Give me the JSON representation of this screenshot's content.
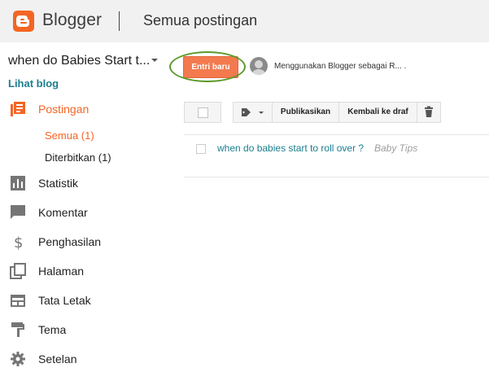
{
  "header": {
    "brand": "Blogger",
    "page_title": "Semua postingan"
  },
  "blog": {
    "name": "when do Babies Start t...",
    "view_blog_label": "Lihat blog"
  },
  "actions": {
    "new_post_label": "Entri baru",
    "using_as": "Menggunakan Blogger sebagai R... ."
  },
  "sidebar": {
    "items": [
      {
        "label": "Postingan",
        "icon": "posts-icon",
        "active": true
      },
      {
        "label": "Statistik",
        "icon": "stats-icon"
      },
      {
        "label": "Komentar",
        "icon": "comment-icon"
      },
      {
        "label": "Penghasilan",
        "icon": "dollar-icon"
      },
      {
        "label": "Halaman",
        "icon": "pages-icon"
      },
      {
        "label": "Tata Letak",
        "icon": "layout-icon"
      },
      {
        "label": "Tema",
        "icon": "paint-roller-icon"
      },
      {
        "label": "Setelan",
        "icon": "gear-icon"
      }
    ],
    "subitems": [
      {
        "label": "Semua (1)",
        "active": true
      },
      {
        "label": "Diterbitkan (1)"
      }
    ]
  },
  "toolbar": {
    "publish_label": "Publikasikan",
    "revert_label": "Kembali ke draf"
  },
  "posts": [
    {
      "title": "when do babies start to roll over ?",
      "label": "Baby Tips"
    }
  ],
  "colors": {
    "accent": "#f46524",
    "link": "#1a7f8e"
  }
}
